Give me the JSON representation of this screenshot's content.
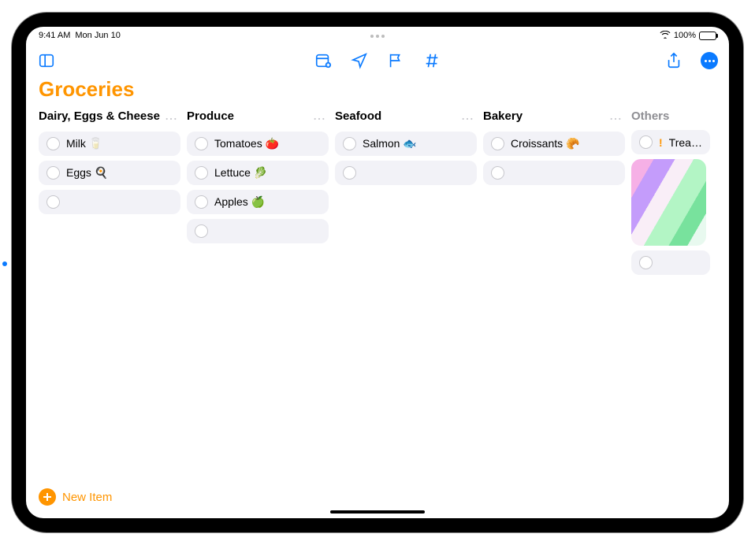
{
  "status": {
    "time": "9:41 AM",
    "date": "Mon Jun 10",
    "battery_percent": "100%"
  },
  "list": {
    "title": "Groceries",
    "accent": "#ff9500"
  },
  "sections": [
    {
      "title": "Dairy, Eggs & Cheese",
      "items": [
        "Milk 🥛",
        "Eggs 🍳"
      ]
    },
    {
      "title": "Produce",
      "items": [
        "Tomatoes 🍅",
        "Lettuce 🥬",
        "Apples 🍏"
      ]
    },
    {
      "title": "Seafood",
      "items": [
        "Salmon 🐟"
      ]
    },
    {
      "title": "Bakery",
      "items": [
        "Croissants 🥐"
      ]
    }
  ],
  "others": {
    "title": "Others",
    "priority_item": {
      "priority": "!",
      "text": "Treats for t"
    }
  },
  "bottom": {
    "new_item_label": "New Item"
  }
}
